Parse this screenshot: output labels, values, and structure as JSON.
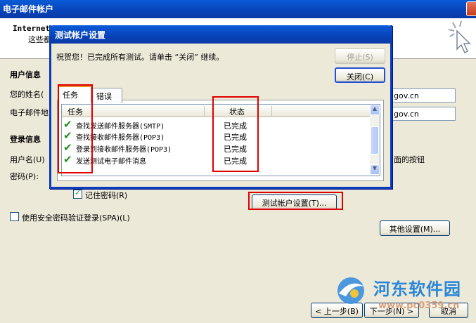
{
  "background_window": {
    "title": "电子邮件帐户",
    "header_title": "Internet",
    "header_subtitle": "这些都",
    "user_info_heading": "用户信息",
    "your_name_label": "您的姓名(",
    "email_label": "电子邮件地",
    "name_value": "gov.cn",
    "email_value": "gov.cn",
    "login_info_heading": "登录信息",
    "username_label": "用户名(U)",
    "password_label": "密码(P):",
    "right_partial_text": "面的按钮",
    "remember_password": "记住密码(R)",
    "remember_password_checked": true,
    "spa_label": "使用安全密码验证登录(SPA)(L)",
    "spa_checked": false,
    "test_account_button": "测试帐户设置(T)...",
    "more_settings_button": "其他设置(M)...",
    "back_button": "< 上一步(B)",
    "next_button": "下一步(N) >",
    "cancel_button": "取消"
  },
  "dialog": {
    "title": "测试帐户设置",
    "message": "祝贺您！已完成所有测试。请单击 “关闭” 继续。",
    "stop_button": "停止(S)",
    "close_button": "关闭(C)",
    "tabs": [
      {
        "label": "任务"
      },
      {
        "label": "错误"
      }
    ],
    "columns": {
      "task": "任务",
      "status": "状态"
    },
    "rows": [
      {
        "task": "查找发送邮件服务器(SMTP)",
        "status": "已完成"
      },
      {
        "task": "查找接收邮件服务器(POP3)",
        "status": "已完成"
      },
      {
        "task": "登录到接收邮件服务器(POP3)",
        "status": "已完成"
      },
      {
        "task": "发送测试电子邮件消息",
        "status": "已完成"
      }
    ],
    "check_glyph": "✔",
    "scroll_up_glyph": "▲",
    "scroll_down_glyph": "▼"
  },
  "watermark": {
    "name": "河东软件园",
    "url": "www.pc0359.cn"
  },
  "colors": {
    "title_blue": "#0843b8",
    "highlight_red": "#e00000",
    "check_green": "#1e8f1e"
  }
}
